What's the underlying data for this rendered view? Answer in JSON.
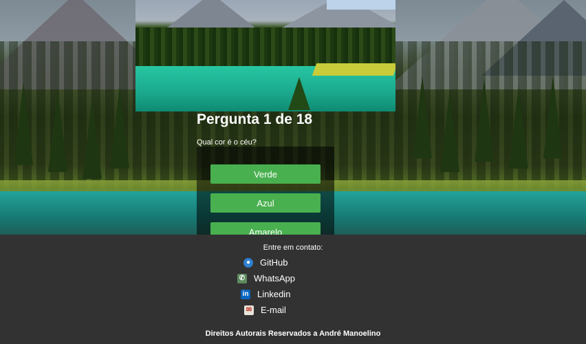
{
  "quiz": {
    "title": "Pergunta 1 de 18",
    "question": "Qual cor é o céu?",
    "answers": [
      "Verde",
      "Azul",
      "Amarelo"
    ],
    "button_color": "#49b04f"
  },
  "footer": {
    "contact_heading": "Entre em contato:",
    "links": [
      {
        "label": "GitHub",
        "icon": "github-icon"
      },
      {
        "label": "WhatsApp",
        "icon": "whatsapp-icon"
      },
      {
        "label": "Linkedin",
        "icon": "linkedin-icon"
      },
      {
        "label": "E-mail",
        "icon": "email-icon"
      }
    ],
    "copyright": "Direitos Autorais Reservados a André Manoelino",
    "background": "#323232"
  }
}
